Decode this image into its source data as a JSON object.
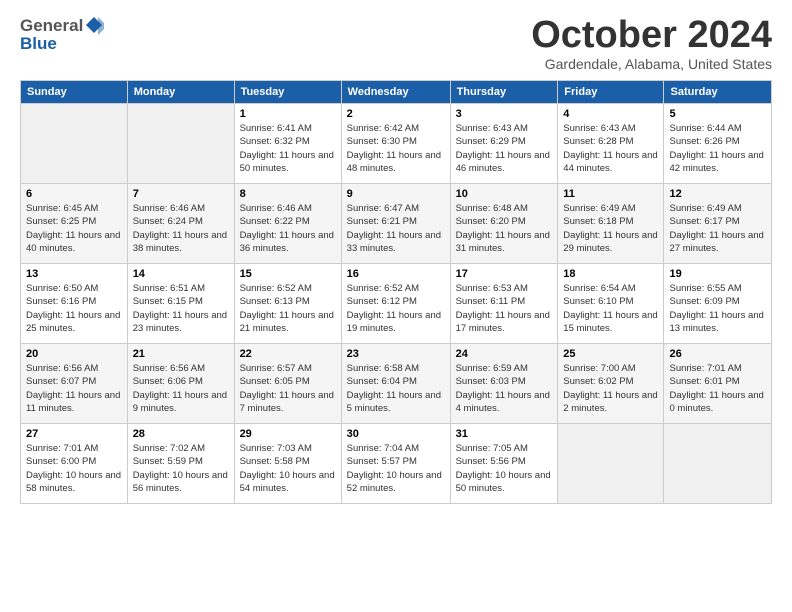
{
  "header": {
    "logo_general": "General",
    "logo_blue": "Blue",
    "month": "October 2024",
    "location": "Gardendale, Alabama, United States"
  },
  "days_of_week": [
    "Sunday",
    "Monday",
    "Tuesday",
    "Wednesday",
    "Thursday",
    "Friday",
    "Saturday"
  ],
  "weeks": [
    [
      {
        "num": "",
        "info": ""
      },
      {
        "num": "",
        "info": ""
      },
      {
        "num": "1",
        "info": "Sunrise: 6:41 AM\nSunset: 6:32 PM\nDaylight: 11 hours and 50 minutes."
      },
      {
        "num": "2",
        "info": "Sunrise: 6:42 AM\nSunset: 6:30 PM\nDaylight: 11 hours and 48 minutes."
      },
      {
        "num": "3",
        "info": "Sunrise: 6:43 AM\nSunset: 6:29 PM\nDaylight: 11 hours and 46 minutes."
      },
      {
        "num": "4",
        "info": "Sunrise: 6:43 AM\nSunset: 6:28 PM\nDaylight: 11 hours and 44 minutes."
      },
      {
        "num": "5",
        "info": "Sunrise: 6:44 AM\nSunset: 6:26 PM\nDaylight: 11 hours and 42 minutes."
      }
    ],
    [
      {
        "num": "6",
        "info": "Sunrise: 6:45 AM\nSunset: 6:25 PM\nDaylight: 11 hours and 40 minutes."
      },
      {
        "num": "7",
        "info": "Sunrise: 6:46 AM\nSunset: 6:24 PM\nDaylight: 11 hours and 38 minutes."
      },
      {
        "num": "8",
        "info": "Sunrise: 6:46 AM\nSunset: 6:22 PM\nDaylight: 11 hours and 36 minutes."
      },
      {
        "num": "9",
        "info": "Sunrise: 6:47 AM\nSunset: 6:21 PM\nDaylight: 11 hours and 33 minutes."
      },
      {
        "num": "10",
        "info": "Sunrise: 6:48 AM\nSunset: 6:20 PM\nDaylight: 11 hours and 31 minutes."
      },
      {
        "num": "11",
        "info": "Sunrise: 6:49 AM\nSunset: 6:18 PM\nDaylight: 11 hours and 29 minutes."
      },
      {
        "num": "12",
        "info": "Sunrise: 6:49 AM\nSunset: 6:17 PM\nDaylight: 11 hours and 27 minutes."
      }
    ],
    [
      {
        "num": "13",
        "info": "Sunrise: 6:50 AM\nSunset: 6:16 PM\nDaylight: 11 hours and 25 minutes."
      },
      {
        "num": "14",
        "info": "Sunrise: 6:51 AM\nSunset: 6:15 PM\nDaylight: 11 hours and 23 minutes."
      },
      {
        "num": "15",
        "info": "Sunrise: 6:52 AM\nSunset: 6:13 PM\nDaylight: 11 hours and 21 minutes."
      },
      {
        "num": "16",
        "info": "Sunrise: 6:52 AM\nSunset: 6:12 PM\nDaylight: 11 hours and 19 minutes."
      },
      {
        "num": "17",
        "info": "Sunrise: 6:53 AM\nSunset: 6:11 PM\nDaylight: 11 hours and 17 minutes."
      },
      {
        "num": "18",
        "info": "Sunrise: 6:54 AM\nSunset: 6:10 PM\nDaylight: 11 hours and 15 minutes."
      },
      {
        "num": "19",
        "info": "Sunrise: 6:55 AM\nSunset: 6:09 PM\nDaylight: 11 hours and 13 minutes."
      }
    ],
    [
      {
        "num": "20",
        "info": "Sunrise: 6:56 AM\nSunset: 6:07 PM\nDaylight: 11 hours and 11 minutes."
      },
      {
        "num": "21",
        "info": "Sunrise: 6:56 AM\nSunset: 6:06 PM\nDaylight: 11 hours and 9 minutes."
      },
      {
        "num": "22",
        "info": "Sunrise: 6:57 AM\nSunset: 6:05 PM\nDaylight: 11 hours and 7 minutes."
      },
      {
        "num": "23",
        "info": "Sunrise: 6:58 AM\nSunset: 6:04 PM\nDaylight: 11 hours and 5 minutes."
      },
      {
        "num": "24",
        "info": "Sunrise: 6:59 AM\nSunset: 6:03 PM\nDaylight: 11 hours and 4 minutes."
      },
      {
        "num": "25",
        "info": "Sunrise: 7:00 AM\nSunset: 6:02 PM\nDaylight: 11 hours and 2 minutes."
      },
      {
        "num": "26",
        "info": "Sunrise: 7:01 AM\nSunset: 6:01 PM\nDaylight: 11 hours and 0 minutes."
      }
    ],
    [
      {
        "num": "27",
        "info": "Sunrise: 7:01 AM\nSunset: 6:00 PM\nDaylight: 10 hours and 58 minutes."
      },
      {
        "num": "28",
        "info": "Sunrise: 7:02 AM\nSunset: 5:59 PM\nDaylight: 10 hours and 56 minutes."
      },
      {
        "num": "29",
        "info": "Sunrise: 7:03 AM\nSunset: 5:58 PM\nDaylight: 10 hours and 54 minutes."
      },
      {
        "num": "30",
        "info": "Sunrise: 7:04 AM\nSunset: 5:57 PM\nDaylight: 10 hours and 52 minutes."
      },
      {
        "num": "31",
        "info": "Sunrise: 7:05 AM\nSunset: 5:56 PM\nDaylight: 10 hours and 50 minutes."
      },
      {
        "num": "",
        "info": ""
      },
      {
        "num": "",
        "info": ""
      }
    ]
  ]
}
